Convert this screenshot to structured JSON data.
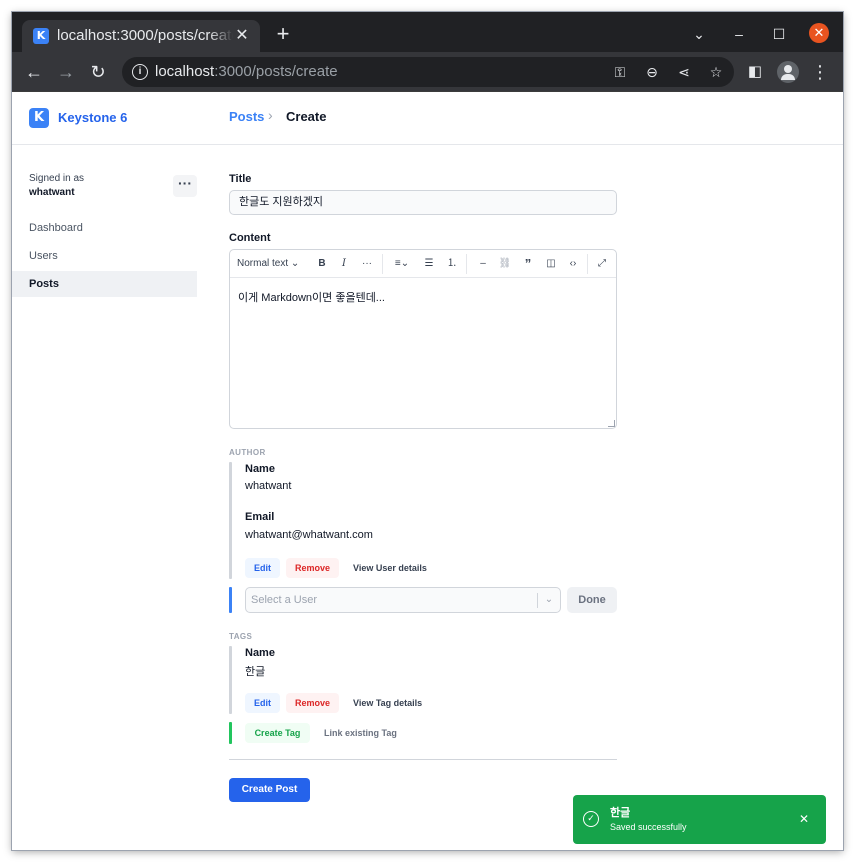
{
  "browser": {
    "tab_title": "localhost:3000/posts/create",
    "favicon_letter": "K",
    "url_host": "localhost",
    "url_rest": ":3000/posts/create"
  },
  "app": {
    "brand_letter": "K",
    "brand_name": "Keystone 6",
    "breadcrumb": {
      "parent": "Posts",
      "current": "Create"
    },
    "signed_in_label": "Signed in as",
    "signed_in_user": "whatwant",
    "nav": [
      {
        "label": "Dashboard",
        "active": false
      },
      {
        "label": "Users",
        "active": false
      },
      {
        "label": "Posts",
        "active": true
      }
    ]
  },
  "form": {
    "title_label": "Title",
    "title_value": "한글도 지원하겠지",
    "content_label": "Content",
    "content_toolbar": {
      "block_type": "Normal text"
    },
    "content_value": "이게 Markdown이면 좋을텐데...",
    "author": {
      "section_label": "AUTHOR",
      "name_label": "Name",
      "name_value": "whatwant",
      "email_label": "Email",
      "email_value": "whatwant@whatwant.com",
      "edit_label": "Edit",
      "remove_label": "Remove",
      "view_label": "View User details",
      "select_placeholder": "Select a User",
      "done_label": "Done"
    },
    "tags": {
      "section_label": "TAGS",
      "name_label": "Name",
      "name_value": "한글",
      "edit_label": "Edit",
      "remove_label": "Remove",
      "view_label": "View Tag details",
      "create_label": "Create Tag",
      "link_label": "Link existing Tag"
    },
    "submit_label": "Create Post"
  },
  "toast": {
    "title": "한글",
    "message": "Saved successfully",
    "color": "#16a34a"
  },
  "colors": {
    "accent": "#2563eb",
    "success": "#16a34a",
    "danger": "#dc2626"
  }
}
